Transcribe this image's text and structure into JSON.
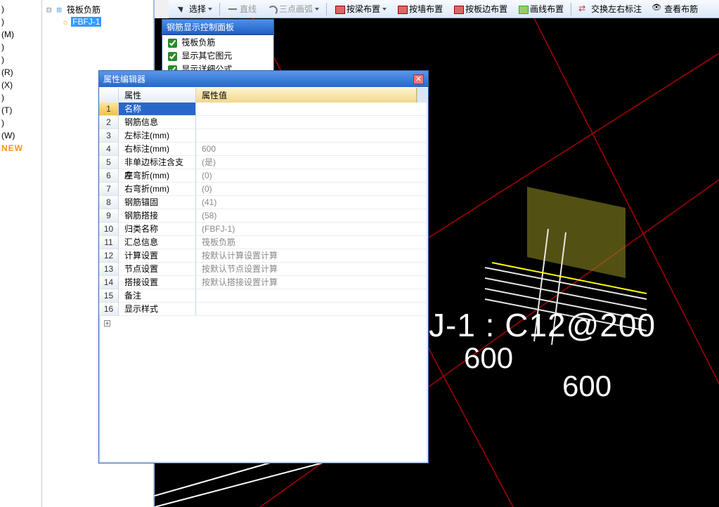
{
  "toolbar": {
    "select": "选择",
    "line": "直线",
    "arc": "三点画弧",
    "beam": "按梁布置",
    "wall": "按墙布置",
    "slab": "按板边布置",
    "drawline": "画线布置",
    "swap": "交换左右标注",
    "view": "查看布筋"
  },
  "stub": {
    "items": [
      "",
      "",
      ")",
      ")",
      "(M)",
      ")",
      ")",
      "(R)",
      "(X)",
      ")",
      "(T)",
      ")",
      "",
      "(W)",
      ""
    ],
    "new": "NEW"
  },
  "tree": {
    "root": "筏板负筋",
    "leaf": "FBFJ-1"
  },
  "controlPanel": {
    "title": "钢筋显示控制面板",
    "items": [
      {
        "label": "筏板负筋",
        "checked": true
      },
      {
        "label": "显示其它图元",
        "checked": true
      },
      {
        "label": "显示详细公式",
        "checked": true
      }
    ]
  },
  "propertyEditor": {
    "title": "属性编辑器",
    "headerName": "属性",
    "headerValue": "属性值",
    "rows": [
      {
        "idx": "1",
        "name": "名称",
        "value": "",
        "selected": true
      },
      {
        "idx": "2",
        "name": "钢筋信息",
        "value": ""
      },
      {
        "idx": "3",
        "name": "左标注(mm)",
        "value": ""
      },
      {
        "idx": "4",
        "name": "右标注(mm)",
        "value": "600"
      },
      {
        "idx": "5",
        "name": "非单边标注含支座",
        "value": "(是)"
      },
      {
        "idx": "6",
        "name": "左弯折(mm)",
        "value": "(0)"
      },
      {
        "idx": "7",
        "name": "右弯折(mm)",
        "value": "(0)"
      },
      {
        "idx": "8",
        "name": "钢筋锚固",
        "value": "(41)"
      },
      {
        "idx": "9",
        "name": "钢筋搭接",
        "value": "(58)"
      },
      {
        "idx": "10",
        "name": "归类名称",
        "value": "(FBFJ-1)"
      },
      {
        "idx": "11",
        "name": "汇总信息",
        "value": "筏板负筋"
      },
      {
        "idx": "12",
        "name": "计算设置",
        "value": "按默认计算设置计算"
      },
      {
        "idx": "13",
        "name": "节点设置",
        "value": "按默认节点设置计算"
      },
      {
        "idx": "14",
        "name": "搭接设置",
        "value": "按默认搭接设置计算"
      },
      {
        "idx": "15",
        "name": "备注",
        "value": ""
      },
      {
        "idx": "16",
        "name": "显示样式",
        "value": "",
        "expander": true
      }
    ]
  },
  "canvas": {
    "mainLabel": "J-1 : C12@200",
    "dimA": "600",
    "dimB": "600"
  }
}
